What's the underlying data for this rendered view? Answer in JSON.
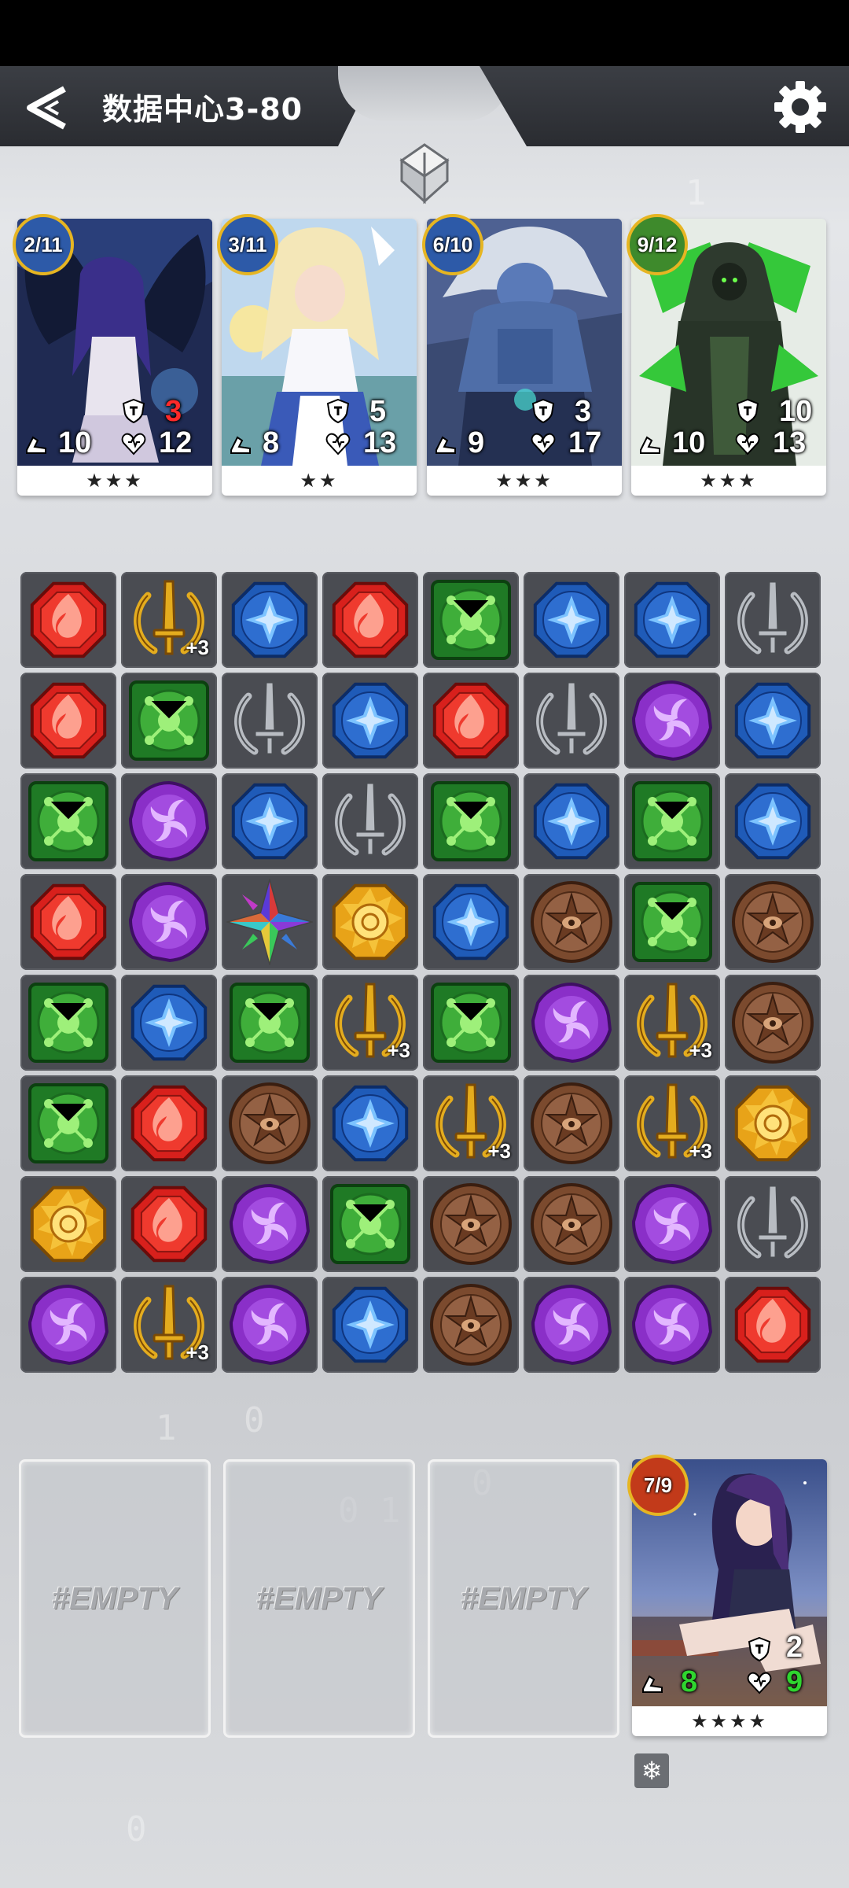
{
  "header": {
    "title": "数据中心3-80"
  },
  "enemies": [
    {
      "badge": "2/11",
      "badge_color": "#2d5aa8",
      "speed": "10",
      "armor": "3",
      "armor_color": "#ff2a2a",
      "hp": "12",
      "stars": "★★★",
      "theme": "dark-angel"
    },
    {
      "badge": "3/11",
      "badge_color": "#2d5aa8",
      "speed": "8",
      "armor": "5",
      "armor_color": "#ffffff",
      "hp": "13",
      "stars": "★★",
      "theme": "light-priestess"
    },
    {
      "badge": "6/10",
      "badge_color": "#2d5aa8",
      "speed": "9",
      "armor": "3",
      "armor_color": "#ffffff",
      "hp": "17",
      "stars": "★★★",
      "theme": "blue-beast"
    },
    {
      "badge": "9/12",
      "badge_color": "#3e8a2c",
      "speed": "10",
      "armor": "10",
      "armor_color": "#ffffff",
      "hp": "13",
      "stars": "★★★",
      "theme": "green-mech"
    }
  ],
  "board": [
    [
      "fire",
      "sword-gold+3",
      "water",
      "fire",
      "nature",
      "water",
      "water",
      "sword-silver"
    ],
    [
      "fire",
      "nature",
      "sword-silver",
      "water",
      "fire",
      "sword-silver",
      "shadow",
      "water"
    ],
    [
      "nature",
      "shadow",
      "water",
      "sword-silver",
      "nature",
      "water",
      "nature",
      "water"
    ],
    [
      "fire",
      "shadow",
      "prism",
      "sun",
      "water",
      "earth",
      "nature",
      "earth"
    ],
    [
      "nature",
      "water",
      "nature",
      "sword-gold+3",
      "nature",
      "shadow",
      "sword-gold+3",
      "earth"
    ],
    [
      "nature",
      "fire",
      "earth",
      "water",
      "sword-gold+3",
      "earth",
      "sword-gold+3",
      "sun"
    ],
    [
      "sun",
      "fire",
      "shadow",
      "nature",
      "earth",
      "earth",
      "shadow",
      "sword-silver"
    ],
    [
      "shadow",
      "sword-gold+3",
      "shadow",
      "water",
      "earth",
      "shadow",
      "shadow",
      "fire"
    ]
  ],
  "bonus_label": "+3",
  "slots": [
    {
      "label": "#EMPTY"
    },
    {
      "label": "#EMPTY"
    },
    {
      "label": "#EMPTY"
    }
  ],
  "hero": {
    "badge": "7/9",
    "badge_color": "#c23a1a",
    "armor": "2",
    "speed": "8",
    "hp": "9",
    "stars": "★★★★"
  },
  "colors": {
    "fire": "#d8201c",
    "water": "#1f5bb8",
    "nature": "#3fae3a",
    "shadow": "#8a2fc8",
    "earth": "#7b4a2e",
    "sun": "#e8a318",
    "gold": "#e4ac1e",
    "silver": "#b8bcc2",
    "hero_stat": "#2fd52f"
  },
  "icons": {
    "back": "back-arrow-icon",
    "settings": "gear-icon",
    "freeze": "snowflake-icon",
    "speed": "boot-icon",
    "armor": "shield-icon",
    "hp": "heart-icon"
  }
}
